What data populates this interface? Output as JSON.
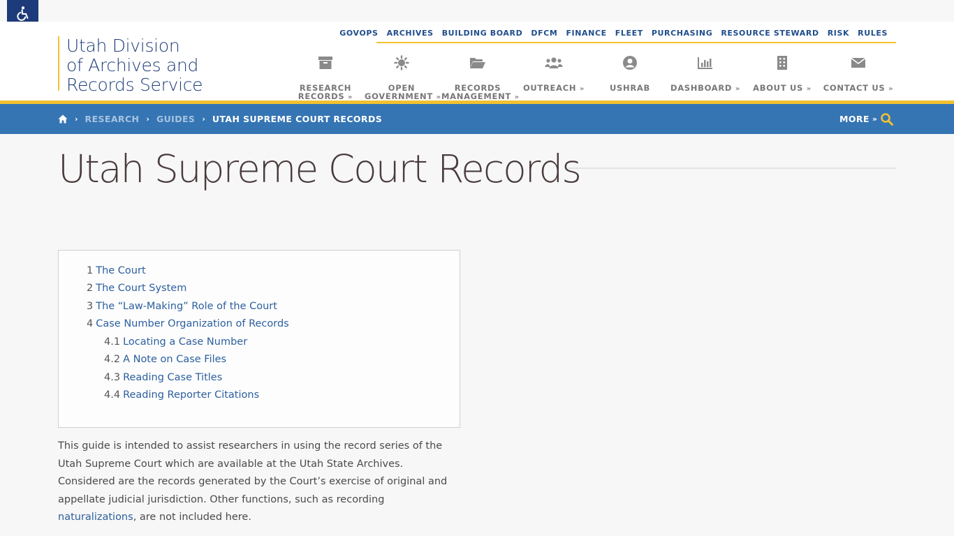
{
  "accessibility": {
    "icon": "wheelchair-icon"
  },
  "logo": {
    "line1": "Utah Division",
    "line2": "of Archives and",
    "line3": "Records Service"
  },
  "util_nav": [
    "GOVOPS",
    "ARCHIVES",
    "BUILDING BOARD",
    "DFCM",
    "FINANCE",
    "FLEET",
    "PURCHASING",
    "RESOURCE STEWARD",
    "RISK",
    "RULES"
  ],
  "main_nav": [
    {
      "line1": "RESEARCH",
      "line2": "RECORDS",
      "icon": "archive-box-icon"
    },
    {
      "line1": "OPEN",
      "line2": "GOVERNMENT",
      "icon": "sun-icon"
    },
    {
      "line1": "RECORDS",
      "line2": "MANAGEMENT",
      "icon": "folder-open-icon"
    },
    {
      "line1": "OUTREACH",
      "line2": "",
      "icon": "users-icon"
    },
    {
      "line1": "USHRAB",
      "line2": "",
      "icon": "user-circle-icon"
    },
    {
      "line1": "DASHBOARD",
      "line2": "",
      "icon": "bar-chart-icon"
    },
    {
      "line1": "ABOUT US",
      "line2": "",
      "icon": "building-icon"
    },
    {
      "line1": "CONTACT US",
      "line2": "",
      "icon": "envelope-icon"
    }
  ],
  "breadcrumb": {
    "home_icon": "home-icon",
    "items": [
      "RESEARCH",
      "GUIDES",
      "UTAH SUPREME COURT RECORDS"
    ],
    "more_label": "MORE"
  },
  "page": {
    "title": "Utah Supreme Court Records"
  },
  "toc": [
    {
      "num": "1",
      "text": "The Court"
    },
    {
      "num": "2",
      "text": "The Court System"
    },
    {
      "num": "3",
      "text": "The “Law-Making” Role of the Court"
    },
    {
      "num": "4",
      "text": "Case Number Organization of Records"
    },
    {
      "num": "4.1",
      "text": "Locating a Case Number"
    },
    {
      "num": "4.2",
      "text": "A Note on Case Files"
    },
    {
      "num": "4.3",
      "text": "Reading Case Titles"
    },
    {
      "num": "4.4",
      "text": "Reading Reporter Citations"
    }
  ],
  "intro": {
    "before_link": "This guide is intended to assist researchers in using the record series of the Utah Supreme Court which are available at the Utah State Archives.  Considered are the records generated by the Court’s exercise of original and appellate judicial jurisdiction.  Other functions, such as recording ",
    "link": "naturalizations",
    "after_link": ", are not included here."
  },
  "colors": {
    "brand_blue": "#1f3d78",
    "accent_yellow": "#f2c230",
    "crumb_bar": "#3575b4",
    "link": "#2c5f9e"
  }
}
